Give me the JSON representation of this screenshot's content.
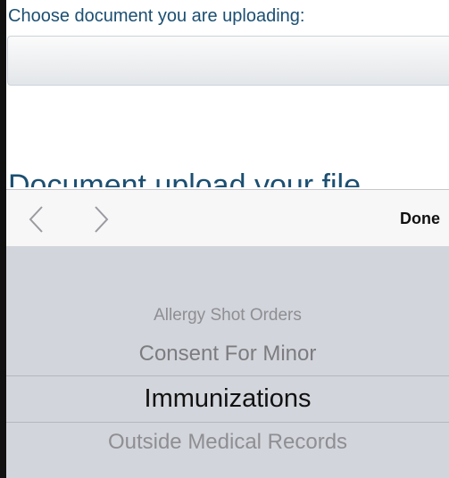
{
  "form": {
    "prompt_label": "Choose document you are uploading:",
    "cut_heading": "Document upload your file"
  },
  "toolbar": {
    "done_label": "Done"
  },
  "picker": {
    "items": [
      "Allergy Shot Orders",
      "Consent For Minor",
      "Immunizations",
      "Outside Medical Records"
    ],
    "selected": "Immunizations"
  },
  "colors": {
    "label_text": "#1b4f72",
    "select_arrow": "#2e86c1",
    "toolbar_bg": "#f7f7f8",
    "picker_bg": "#d2d5db"
  }
}
